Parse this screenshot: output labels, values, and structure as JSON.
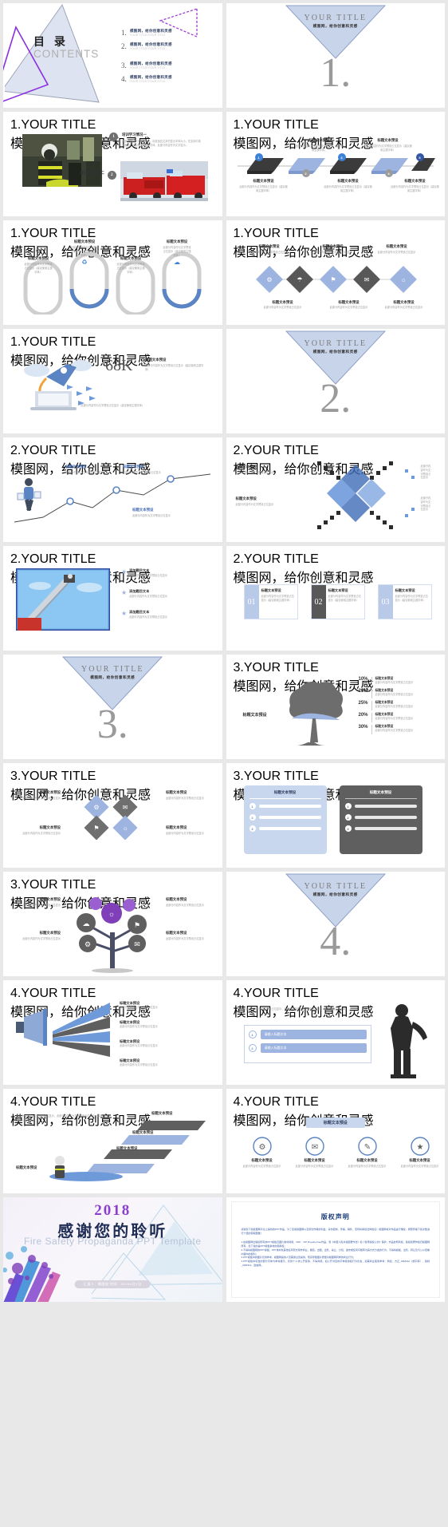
{
  "meta": {
    "template_name": "Fire Safety Propaganda PPT Template",
    "accent_blue": "#5b84c4",
    "accent_light": "#c8d4ea",
    "accent_purple": "#8b3fd0",
    "dark_gray": "#585858"
  },
  "common": {
    "your_title": "YOUR TITLE",
    "subtitle_zh": "模图网，给你创意和灵感",
    "section_label": "标题文本预设",
    "body_text": "此部分内容作为文字预设占位显示（建议使用主题字体）",
    "body_text_short": "此部分内容作为文字预设占位显示"
  },
  "cover": {
    "title_zh": "目 录",
    "title_en": "CONTENTS",
    "items": [
      {
        "n": "1.",
        "zh": "模图网，给你创意和灵感",
        "en": "YOUR TITLE/YOUR TITLE"
      },
      {
        "n": "2.",
        "zh": "模图网，给你创意和灵感",
        "en": "YOUR TITLE/YOUR TITLE"
      },
      {
        "n": "3.",
        "zh": "模图网，给你创意和灵感",
        "en": "YOUR TITLE/YOUR TITLE"
      },
      {
        "n": "4.",
        "zh": "模图网，给你创意和灵感",
        "en": "YOUR TITLE/YOUR TITLE"
      }
    ]
  },
  "sections": [
    {
      "num": "1.",
      "title": "YOUR TITLE",
      "sub": "模图网，给你创意和灵感"
    },
    {
      "num": "2.",
      "title": "YOUR TITLE",
      "sub": "模图网，给你创意和灵感"
    },
    {
      "num": "3.",
      "title": "YOUR TITLE",
      "sub": "模图网，给你创意和灵感"
    },
    {
      "num": "4.",
      "title": "YOUR TITLE",
      "sub": "模图网，给你创意和灵感"
    }
  ],
  "slides": {
    "photo_intro": {
      "num": "1.",
      "title": "YOUR TITLE",
      "sub": "模图网，给你创意和灵感",
      "item1_title": "培训学习情况一",
      "item1_body": "此部分内容作为文字预设，标准适应文本的显示字体大小，在支持中英文版面，并建议内容展示字体，此部分内容作为文字显示。",
      "item2_title": "培训学习情况二",
      "badge1": "1",
      "badge2": "2"
    },
    "timeline": {
      "num": "1.",
      "title": "YOUR TITLE",
      "sub": "模图网，给你创意和灵感",
      "steps": [
        {
          "n": "1",
          "label": "标题文本预设"
        },
        {
          "n": "2",
          "label": "标题文本预设"
        },
        {
          "n": "3",
          "label": "标题文本预设"
        },
        {
          "n": "4",
          "label": "标题文本预设"
        },
        {
          "n": "5",
          "label": "标题文本预设"
        }
      ]
    },
    "capsules": {
      "num": "1.",
      "title": "YOUR TITLE",
      "sub": "模图网，给你创意和灵感",
      "items": [
        {
          "icon": "gear-icon",
          "label": "标题文本预设",
          "body": "此部分内容作为文字预设占位显示（建议使用主题字体）"
        },
        {
          "icon": "recycle-icon",
          "label": "标题文本预设",
          "body": "此部分内容作为文字预设占位显示（建议使用主题字体）"
        },
        {
          "icon": "monitor-icon",
          "label": "标题文本预设",
          "body": "此部分内容作为文字预设占位显示（建议使用主题字体）"
        },
        {
          "icon": "cloud-icon",
          "label": "标题文本预设",
          "body": "此部分内容作为文字预设占位显示（建议使用主题字体）"
        }
      ]
    },
    "diamonds": {
      "num": "1.",
      "title": "YOUR TITLE",
      "sub": "模图网，给你创意和灵感",
      "items": [
        {
          "label": "标题文本预设",
          "body": "此部分内容作为文字预设占位显示"
        },
        {
          "label": "标题文本预设",
          "body": "此部分内容作为文字预设占位显示"
        },
        {
          "label": "标题文本预设",
          "body": "此部分内容作为文字预设占位显示"
        }
      ]
    },
    "rocket": {
      "num": "1.",
      "title": "YOUR TITLE",
      "sub": "模图网，给你创意和灵感",
      "metric": "68K",
      "metric_label": "标题文本预设",
      "metric_body": "此部分内容作为文字预设占位显示（建议使用主题字体）",
      "footer": "此部分内容作为文字预设占位显示（建议使用主题字体）"
    },
    "linechart": {
      "num": "2.",
      "title": "YOUR TITLE",
      "sub": "模图网，给你创意和灵感",
      "nodes": [
        {
          "label": "标题文本预设"
        },
        {
          "label": "标题文本预设"
        },
        {
          "label": "标题文本预设"
        }
      ]
    },
    "xcross": {
      "num": "2.",
      "title": "YOUR TITLE",
      "sub": "模图网，给你创意和灵感",
      "items": [
        {
          "label": "标题文本预设",
          "body": "此部分内容作为文字预设占位显示"
        },
        {
          "label": "标题文本预设",
          "body": "此部分内容作为文字预设占位显示"
        },
        {
          "label": "标题文本预设",
          "body": "此部分内容作为文字预设占位显示"
        },
        {
          "label": "标题文本预设",
          "body": "此部分内容作为文字预设占位显示"
        }
      ]
    },
    "ladder_photo": {
      "num": "2.",
      "title": "YOUR TITLE",
      "sub": "模图网，给你创意和灵感",
      "items": [
        {
          "label": "添加题目文本",
          "body": "此部分内容作为文字预设占位显示"
        },
        {
          "label": "添加题目文本",
          "body": "此部分内容作为文字预设占位显示"
        },
        {
          "label": "添加题目文本",
          "body": "此部分内容作为文字预设占位显示"
        }
      ]
    },
    "numcards": {
      "num": "2.",
      "title": "YOUR TITLE",
      "sub": "模图网，给你创意和灵感",
      "cards": [
        {
          "n": "01",
          "label": "标题文本预设",
          "body": "此部分内容作为文字预设占位显示（建议使用主题字体）",
          "style": "light"
        },
        {
          "n": "02",
          "label": "标题文本预设",
          "body": "此部分内容作为文字预设占位显示（建议使用主题字体）",
          "style": "dark"
        },
        {
          "n": "03",
          "label": "标题文本预设",
          "body": "此部分内容作为文字预设占位显示（建议使用主题字体）",
          "style": "light"
        }
      ]
    },
    "tree_percent": {
      "num": "3.",
      "title": "YOUR TITLE",
      "sub": "模图网，给你创意和灵感",
      "center_label": "标题文本预设",
      "rows": [
        {
          "pct": "10%",
          "label": "标题文本预设",
          "body": "此部分内容作为文字预设占位显示"
        },
        {
          "pct": "25%",
          "label": "标题文本预设",
          "body": "此部分内容作为文字预设占位显示"
        },
        {
          "pct": "25%",
          "label": "标题文本预设",
          "body": "此部分内容作为文字预设占位显示"
        },
        {
          "pct": "20%",
          "label": "标题文本预设",
          "body": "此部分内容作为文字预设占位显示"
        },
        {
          "pct": "30%",
          "label": "标题文本预设",
          "body": "此部分内容作为文字预设占位显示"
        }
      ]
    },
    "diamond4": {
      "num": "3.",
      "title": "YOUR TITLE",
      "sub": "模图网，给你创意和灵感",
      "items": [
        {
          "label": "标题文本预设",
          "body": "此部分内容作为文字预设占位显示"
        },
        {
          "label": "标题文本预设",
          "body": "此部分内容作为文字预设占位显示"
        },
        {
          "label": "标题文本预设",
          "body": "此部分内容作为文字预设占位显示"
        },
        {
          "label": "标题文本预设",
          "body": "此部分内容作为文字预设占位显示"
        }
      ]
    },
    "twopanel": {
      "num": "3.",
      "title": "YOUR TITLE",
      "sub": "模图网，给你创意和灵感",
      "left_title": "标题文本预设",
      "right_title": "标题文本预设",
      "rows": [
        {
          "n": "1",
          "label": "此部分内容作为文字预设占位显示"
        },
        {
          "n": "2",
          "label": "此部分内容作为文字预设占位显示"
        },
        {
          "n": "3",
          "label": "此部分内容作为文字预设占位显示"
        }
      ]
    },
    "tree_icons": {
      "num": "3.",
      "title": "YOUR TITLE",
      "sub": "模图网，给你创意和灵感",
      "items": [
        {
          "label": "标题文本预设",
          "body": "此部分内容作为文字预设占位显示"
        },
        {
          "label": "标题文本预设",
          "body": "此部分内容作为文字预设占位显示"
        },
        {
          "label": "标题文本预设",
          "body": "此部分内容作为文字预设占位显示"
        },
        {
          "label": "标题文本预设",
          "body": "此部分内容作为文字预设占位显示"
        }
      ]
    },
    "megaphone": {
      "num": "4.",
      "title": "YOUR TITLE",
      "sub": "模图网，给你创意和灵感",
      "items": [
        {
          "label": "标题文本预设",
          "body": "此部分内容作为文字预设占位显示"
        },
        {
          "label": "标题文本预设",
          "body": "此部分内容作为文字预设占位显示"
        },
        {
          "label": "标题文本预设",
          "body": "此部分内容作为文字预设占位显示"
        },
        {
          "label": "标题文本预设",
          "body": "此部分内容作为文字预设占位显示"
        }
      ]
    },
    "businessman": {
      "num": "4.",
      "title": "YOUR TITLE",
      "sub": "模图网，给你创意和灵感",
      "intro": "此部分内容作为文字预设占位显示，此部分内容作为文字预设占位显示（建议使用主题字体）",
      "rows": [
        {
          "n": "1",
          "label": "请输入标题文本"
        },
        {
          "n": "2",
          "label": "请输入标题文本"
        }
      ]
    },
    "stairs": {
      "num": "4.",
      "title": "YOUR TITLE",
      "sub": "模图网，给你创意和灵感",
      "intro": "此部分内容作为文字预设占位显示，此部分内容作为文字预设占位显示（建议使用主题字体）",
      "steps": [
        {
          "label": "标题文本预设"
        },
        {
          "label": "标题文本预设"
        },
        {
          "label": "标题文本预设"
        },
        {
          "label": "标题文本预设"
        }
      ]
    },
    "badges4": {
      "num": "4.",
      "title": "YOUR TITLE",
      "sub": "模图网，给你创意和灵感",
      "header": "标题文本预设",
      "items": [
        {
          "icon": "gear-icon",
          "label": "标题文本预设",
          "body": "此部分内容作为文字预设占位显示"
        },
        {
          "icon": "mail-icon",
          "label": "标题文本预设",
          "body": "此部分内容作为文字预设占位显示"
        },
        {
          "icon": "feather-icon",
          "label": "标题文本预设",
          "body": "此部分内容作为文字预设占位显示"
        },
        {
          "icon": "star-icon",
          "label": "标题文本预设",
          "body": "此部分内容作为文字预设占位显示"
        }
      ]
    }
  },
  "thanks": {
    "year": "2018",
    "title_zh": "感谢您的聆听",
    "title_en": "Fire Safety Propaganda PPT Template",
    "footer": "汇报人：模图网    时间：2019X月X日"
  },
  "copyright": {
    "title": "版权声明",
    "intro": "感谢您下载模图网平台上提供的PPT作品，为了您和模图网以及原创作者的利益，请勿复制、传播、销售，否则将承担法律责任！模图网将对作品进行维权，按照传播下载次数进行十倍的索取赔偿！",
    "items": [
      "1.在模图网出版权所有的PPT模板及图片素材商用，VRF：VIP Royalty-Free作品，受《中国人民共和国著作法》和《世界版权公约》保护，作品的所有权、版权和著作权归模图网所有，您下载的是PPT模板素材的使用权；",
      "2.不得将模图网的PPT模板、PPT素材化其他任何形式用作商业，擅自、出租、出售、禁止、分包、发布或任何可能转为其方式分发的行为，不得将模板、出售、转让及与公众查看内容中的权利；",
      "3.PPT模板中的图片仅供参考，模图网提供人员需通过该提供，现实导致图片质量对模图网同样的商业行为；",
      "4.PPT模板中包含的部分字体为参考展示，仅供个人非公开使用，不得商用。如公开对目的字体使用权行为负责，如需商业使用参考：例如，方正_GBZ312（或字库）、锐线_GBZ312、勘启网。"
    ]
  }
}
